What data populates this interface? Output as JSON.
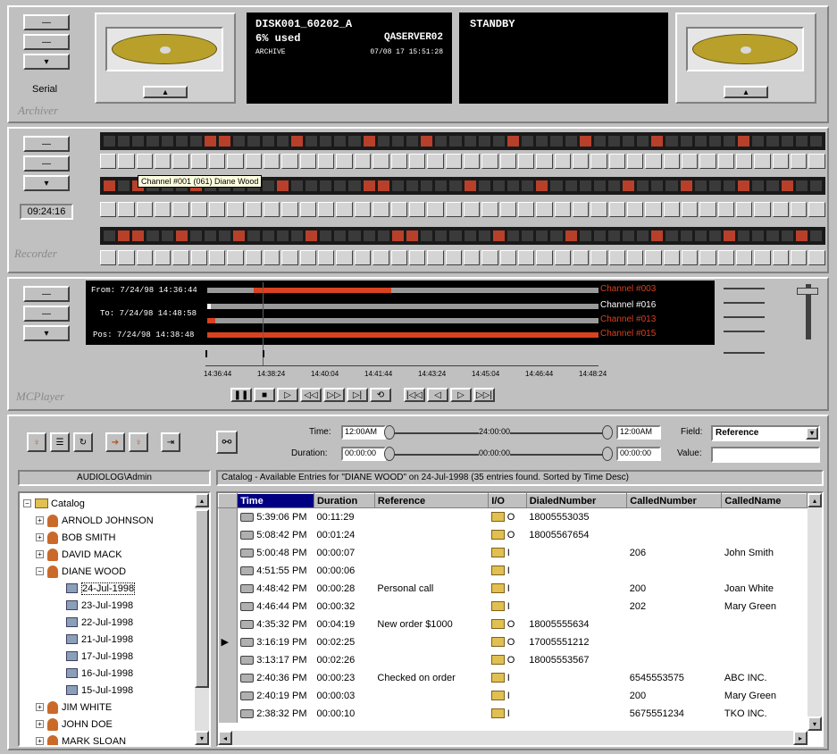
{
  "archiver": {
    "label": "Archiver",
    "serial_label": "Serial",
    "disk_name": "DISK001_60202_A",
    "used": "6% used",
    "server": "QASERVER02",
    "status_left": "ARCHIVE",
    "timestamp": "07/08 17 15:51:28",
    "state": "STANDBY"
  },
  "recorder": {
    "label": "Recorder",
    "time": "09:24:16",
    "tooltip": "Channel #001 (061) Diane Wood"
  },
  "mcplayer": {
    "label": "MCPlayer",
    "from": "From: 7/24/98 14:36:44",
    "to": "To: 7/24/98 14:48:58",
    "pos": "Pos: 7/24/98 14:38:48",
    "channels": [
      "Channel #003",
      "Channel #016",
      "Channel #013",
      "Channel #015"
    ],
    "ticks": [
      "14:36:44",
      "14:38:24",
      "14:40:04",
      "14:41:44",
      "14:43:24",
      "14:45:04",
      "14:46:44",
      "14:48:24"
    ],
    "progress": [
      0.4,
      0.0,
      0.02,
      1.0
    ]
  },
  "filters": {
    "time_label": "Time:",
    "time_start": "12:00AM",
    "time_mid": "24:00:00",
    "time_end": "12:00AM",
    "duration_label": "Duration:",
    "dur_start": "00:00:00",
    "dur_mid": "00:00:00",
    "dur_end": "00:00:00",
    "field_label": "Field:",
    "field_value": "Reference",
    "value_label": "Value:",
    "value_value": ""
  },
  "user": "AUDIOLOG\\Admin",
  "catalog_status": "Catalog - Available Entries for \"DIANE WOOD\" on 24-Jul-1998 (35 entries found. Sorted by Time Desc)",
  "tree": {
    "root": "Catalog",
    "items": [
      {
        "label": "ARNOLD JOHNSON",
        "kind": "person",
        "level": 1
      },
      {
        "label": "BOB SMITH",
        "kind": "person",
        "level": 1
      },
      {
        "label": "DAVID MACK",
        "kind": "person",
        "level": 1
      },
      {
        "label": "DIANE WOOD",
        "kind": "person",
        "level": 1
      },
      {
        "label": "24-Jul-1998",
        "kind": "date",
        "level": 2
      },
      {
        "label": "23-Jul-1998",
        "kind": "date",
        "level": 2
      },
      {
        "label": "22-Jul-1998",
        "kind": "date",
        "level": 2
      },
      {
        "label": "21-Jul-1998",
        "kind": "date",
        "level": 2
      },
      {
        "label": "17-Jul-1998",
        "kind": "date",
        "level": 2
      },
      {
        "label": "16-Jul-1998",
        "kind": "date",
        "level": 2
      },
      {
        "label": "15-Jul-1998",
        "kind": "date",
        "level": 2
      },
      {
        "label": "JIM WHITE",
        "kind": "person",
        "level": 1
      },
      {
        "label": "JOHN DOE",
        "kind": "person",
        "level": 1
      },
      {
        "label": "MARK SLOAN",
        "kind": "person",
        "level": 1
      }
    ]
  },
  "table": {
    "columns": [
      "Time",
      "Duration",
      "Reference",
      "I/O",
      "DialedNumber",
      "CalledNumber",
      "CalledName"
    ],
    "rows": [
      [
        "5:39:06 PM",
        "00:11:29",
        "",
        "O",
        "18005553035",
        "",
        ""
      ],
      [
        "5:08:42 PM",
        "00:01:24",
        "",
        "O",
        "18005567654",
        "",
        ""
      ],
      [
        "5:00:48 PM",
        "00:00:07",
        "",
        "I",
        "",
        "206",
        "John Smith"
      ],
      [
        "4:51:55 PM",
        "00:00:06",
        "",
        "I",
        "",
        "",
        ""
      ],
      [
        "4:48:42 PM",
        "00:00:28",
        "Personal call",
        "I",
        "",
        "200",
        "Joan White"
      ],
      [
        "4:46:44 PM",
        "00:00:32",
        "",
        "I",
        "",
        "202",
        "Mary Green"
      ],
      [
        "4:35:32 PM",
        "00:04:19",
        "New order $1000",
        "O",
        "18005555634",
        "",
        ""
      ],
      [
        "3:16:19 PM",
        "00:02:25",
        "",
        "O",
        "17005551212",
        "",
        ""
      ],
      [
        "3:13:17 PM",
        "00:02:26",
        "",
        "O",
        "18005553567",
        "",
        ""
      ],
      [
        "2:40:36 PM",
        "00:00:23",
        "Checked on order",
        "I",
        "",
        "6545553575",
        "ABC INC."
      ],
      [
        "2:40:19 PM",
        "00:00:03",
        "",
        "I",
        "",
        "200",
        "Mary Green"
      ],
      [
        "2:38:32 PM",
        "00:00:10",
        "",
        "I",
        "",
        "5675551234",
        "TKO INC."
      ]
    ]
  }
}
